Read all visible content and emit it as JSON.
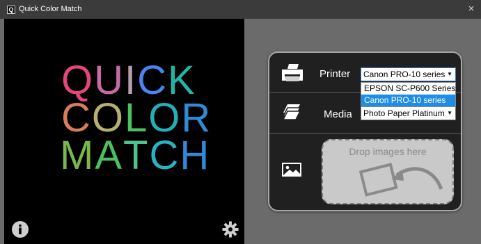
{
  "window": {
    "icon_letter": "Q",
    "title": "Quick Color Match",
    "close_glyph": "×"
  },
  "logo": {
    "lines": [
      {
        "text": "QUICK",
        "colors": [
          "#e6457c",
          "#c86aa9",
          "#b8a0b0",
          "#4a84f0",
          "#21b5a8"
        ]
      },
      {
        "text": "COLOR",
        "colors": [
          "#d87d57",
          "#b6b06e",
          "#4cc05f",
          "#22b0b8",
          "#2f8bd8"
        ]
      },
      {
        "text": "MATCH",
        "colors": [
          "#7ab84f",
          "#4cc05f",
          "#4ec38e",
          "#29b2c0",
          "#2f8bd8"
        ]
      }
    ]
  },
  "footer_icons": {
    "info": "info-icon",
    "settings": "gear-icon"
  },
  "panel": {
    "printer": {
      "icon": "printer-icon",
      "label": "Printer",
      "selected": "Canon PRO-10 series",
      "options": [
        "EPSON SC-P600 Series",
        "Canon PRO-10 series"
      ],
      "highlighted_index": 1
    },
    "media": {
      "icon": "paper-stack-icon",
      "label": "Media",
      "selected": "Photo Paper Platinum"
    },
    "drop": {
      "icon": "image-icon",
      "text": "Drop images here"
    }
  },
  "colors": {
    "highlight": "#1e8de6",
    "panel_bg": "#202020",
    "window_bg": "#6b6b6b"
  }
}
